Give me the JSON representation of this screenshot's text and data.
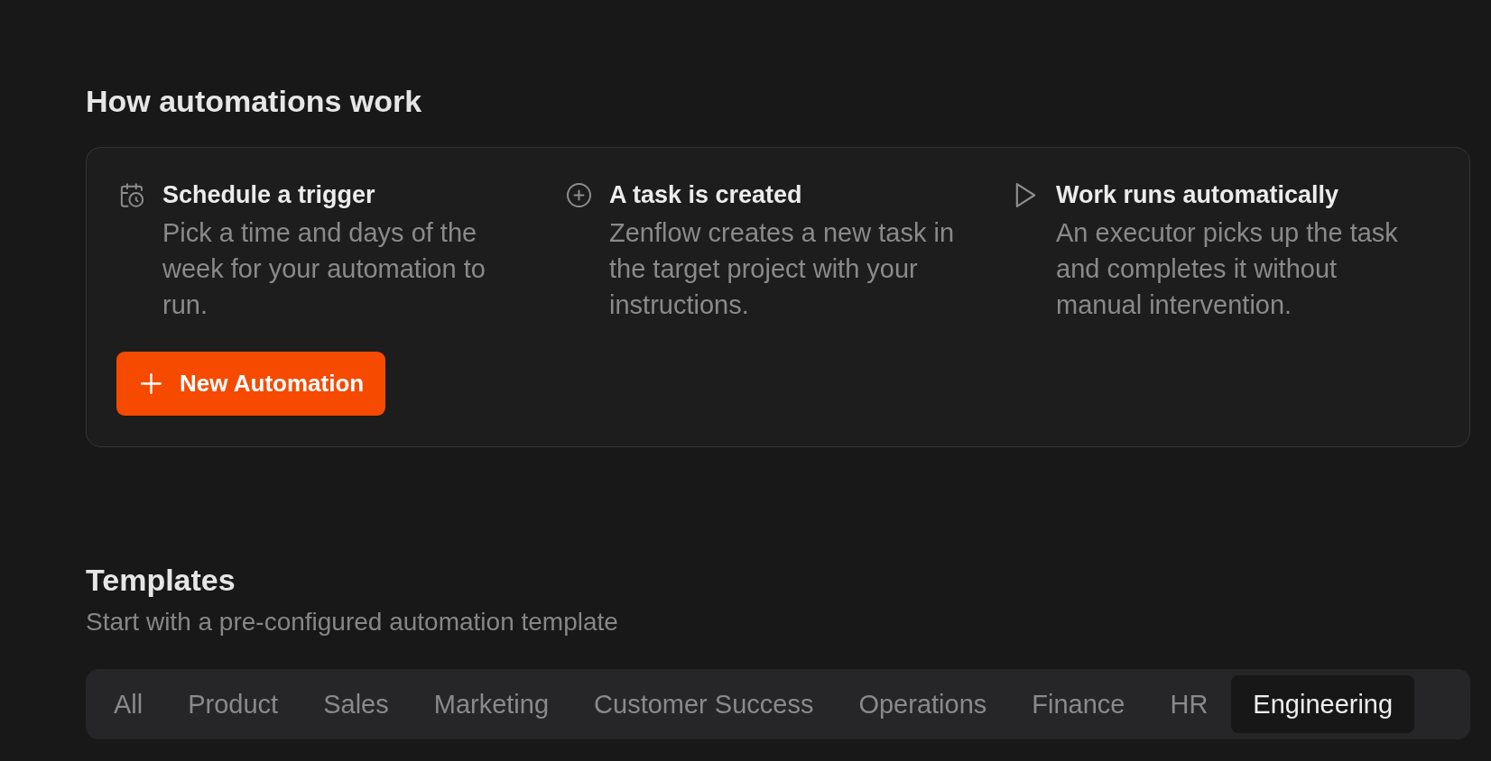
{
  "heading": "How automations work",
  "steps": [
    {
      "kind": "schedule",
      "title": "Schedule a trigger",
      "description": "Pick a time and days of the week for your automation to run."
    },
    {
      "kind": "create",
      "title": "A task is created",
      "description": "Zenflow creates a new task in the target project with your instructions."
    },
    {
      "kind": "run",
      "title": "Work runs automatically",
      "description": "An executor picks up the task and completes it without manual intervention."
    }
  ],
  "new_automation_button": {
    "label": "New Automation"
  },
  "templates": {
    "title": "Templates",
    "subtitle": "Start with a pre-configured automation template",
    "tabs": [
      {
        "label": "All",
        "selected": false
      },
      {
        "label": "Product",
        "selected": false
      },
      {
        "label": "Sales",
        "selected": false
      },
      {
        "label": "Marketing",
        "selected": false
      },
      {
        "label": "Customer Success",
        "selected": false
      },
      {
        "label": "Operations",
        "selected": false
      },
      {
        "label": "Finance",
        "selected": false
      },
      {
        "label": "HR",
        "selected": false
      },
      {
        "label": "Engineering",
        "selected": true
      }
    ]
  }
}
